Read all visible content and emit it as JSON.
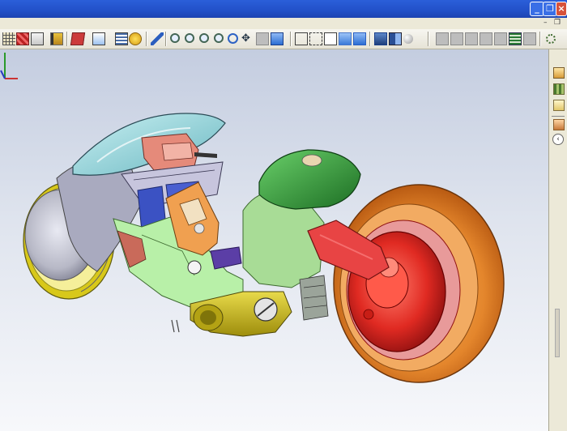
{
  "window": {
    "title": "",
    "controls": {
      "minimize": "_",
      "maximize": "❐",
      "close": "×"
    }
  },
  "document_controls": {
    "minimize": "–",
    "restore": "❐"
  },
  "toolbar": {
    "icons": [
      "table-icon",
      "color-table-icon",
      "layers-dropdown-icon",
      "dimension-icon",
      "appearance-dropdown-icon",
      "display-dropdown-icon",
      "list-icon",
      "help-icon",
      "select-icon",
      "zoom-to-fit-icon",
      "zoom-area-icon",
      "zoom-in-out-icon",
      "zoom-selection-icon",
      "rotate-icon",
      "pan-icon",
      "3d-view-icon",
      "standard-views-dropdown-icon",
      "wireframe-icon",
      "hidden-lines-visible-icon",
      "hidden-lines-removed-icon",
      "shaded-with-edges-icon",
      "shaded-icon",
      "shadows-icon",
      "section-view-icon",
      "realview-icon",
      "sketch-icon",
      "drawing-icon",
      "dimension-tool-icon",
      "annotate-icon",
      "sheet-icon",
      "table-tool-icon",
      "note-icon",
      "gear-icon"
    ]
  },
  "taskpane": {
    "icons": [
      "home-icon",
      "design-library-icon",
      "file-explorer-icon",
      "properties-icon"
    ],
    "collapse": "‹"
  },
  "model": {
    "colors": {
      "front_tire_rim": "#d8c81a",
      "front_tire": "#b7b8c6",
      "canopy": "#8fd1d8",
      "seat_box": "#e58a7a",
      "side_panel": "#b8f0a8",
      "console": "#f0a050",
      "purple_block": "#5b3ea6",
      "rear_fender": "#2f9f3a",
      "rear_tire": "#e4862c",
      "rear_hub": "#e02a22",
      "swingarm": "#e84444",
      "yellow_bracket": "#c9b71a"
    }
  }
}
